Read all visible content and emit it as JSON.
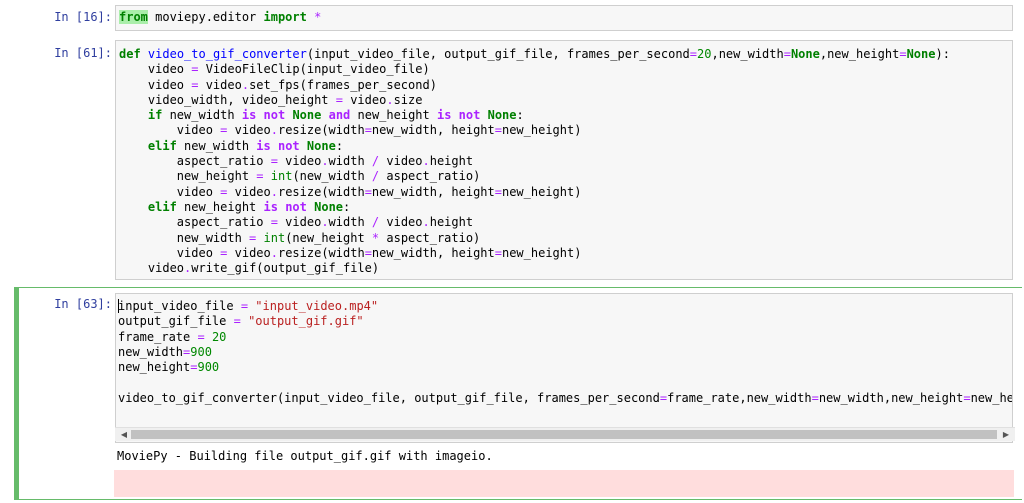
{
  "cells": [
    {
      "prompt": "In [16]:"
    },
    {
      "prompt": "In [61]:"
    },
    {
      "prompt": "In [63]:"
    }
  ],
  "output": {
    "text": "MoviePy - Building file output_gif.gif with imageio."
  },
  "scrollbar": {
    "left_arrow": "◀",
    "right_arrow": "▶"
  },
  "colors": {
    "prompt": "#303f9f",
    "keyword": "#008000",
    "operator": "#aa22ff",
    "function": "#0000ff",
    "string": "#ba2121",
    "selected_border": "#66bb6a",
    "stderr_bg": "#ffdddd"
  }
}
